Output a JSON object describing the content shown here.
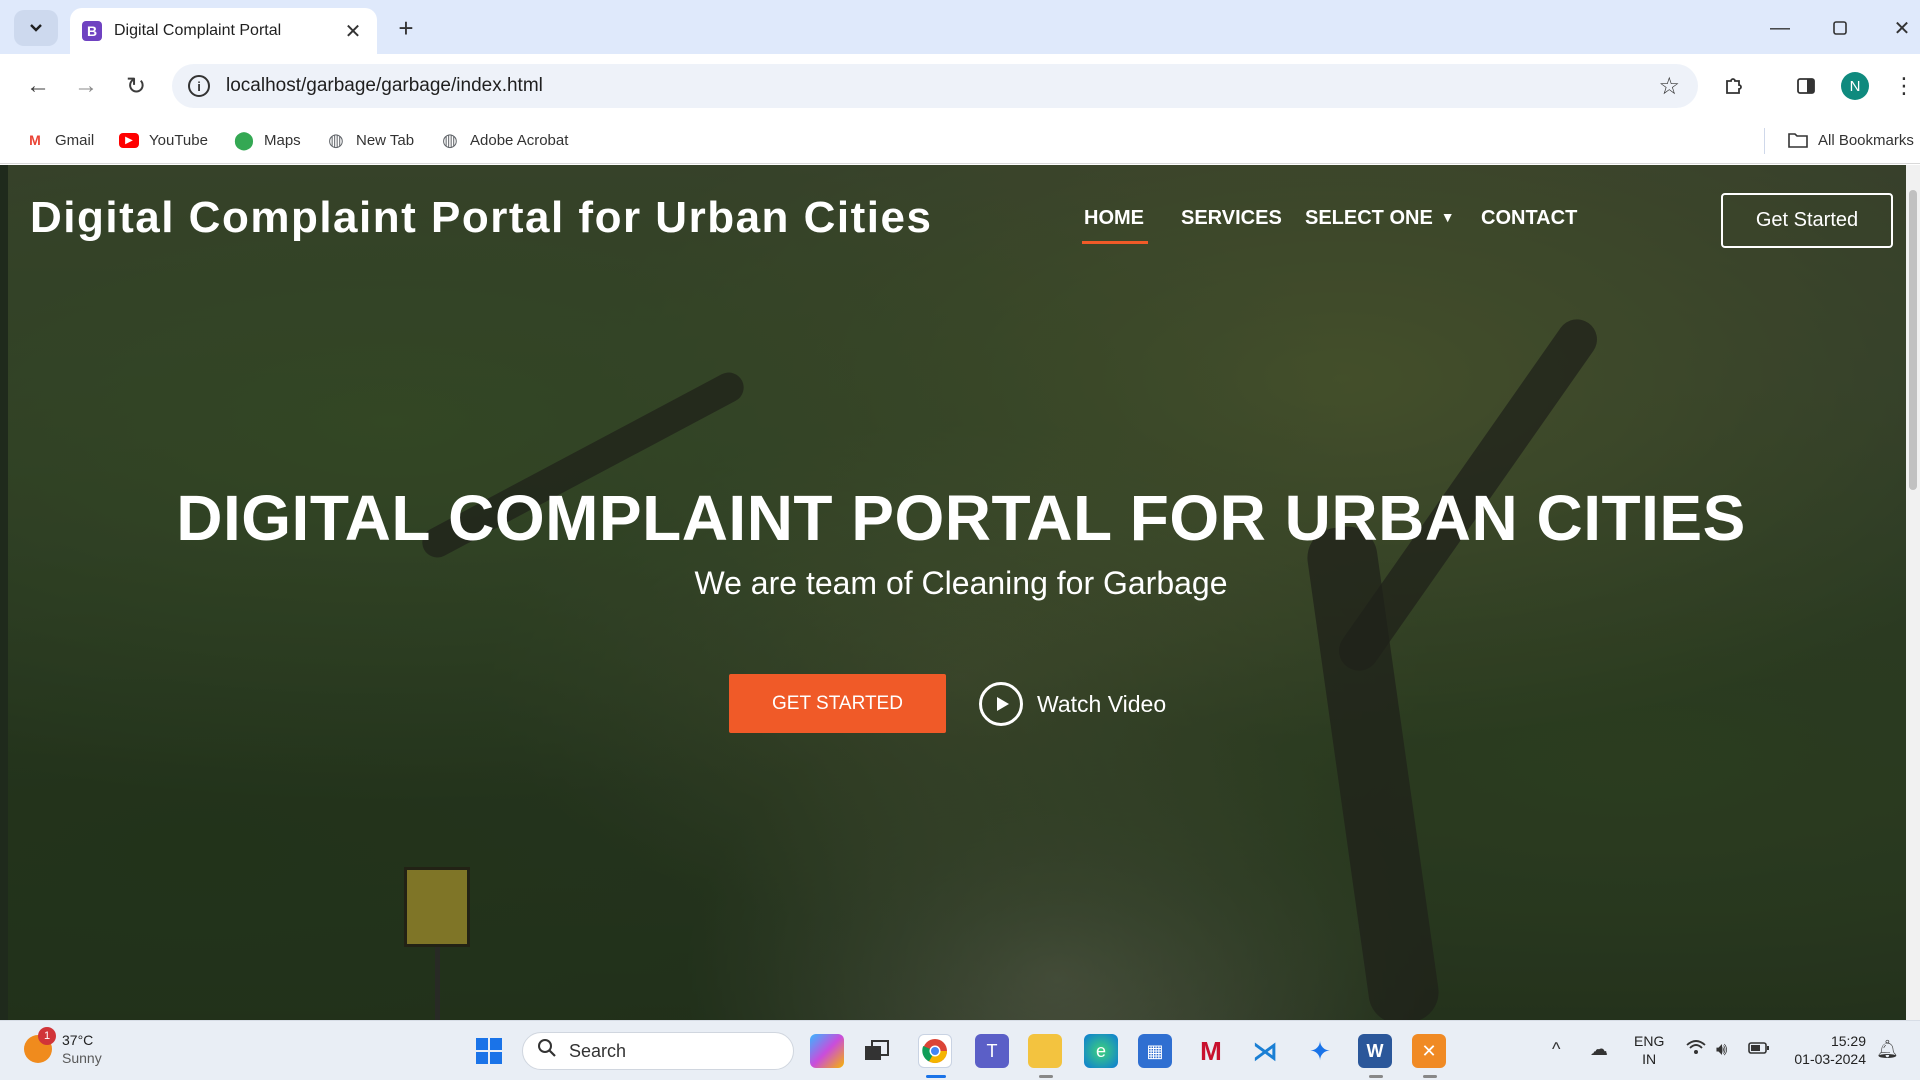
{
  "browser": {
    "tab_title": "Digital Complaint Portal",
    "tab_favicon_letter": "B",
    "url": "localhost/garbage/garbage/index.html",
    "profile_initial": "N",
    "bookmarks": [
      {
        "label": "Gmail",
        "icon": "gmail-icon",
        "color": "#ea4335"
      },
      {
        "label": "YouTube",
        "icon": "youtube-icon",
        "color": "#ff0000"
      },
      {
        "label": "Maps",
        "icon": "maps-icon",
        "color": "#34a853"
      },
      {
        "label": "New Tab",
        "icon": "globe-icon",
        "color": "#5f6368"
      },
      {
        "label": "Adobe Acrobat",
        "icon": "globe-icon",
        "color": "#5f6368"
      }
    ],
    "all_bookmarks_label": "All Bookmarks"
  },
  "site": {
    "logo": "Digital Complaint Portal for Urban Cities",
    "nav": {
      "home": "HOME",
      "services": "SERVICES",
      "select_one": "SELECT ONE",
      "contact": "CONTACT"
    },
    "nav_cta": "Get Started",
    "hero": {
      "title": "DIGITAL COMPLAINT PORTAL FOR URBAN CITIES",
      "subtitle": "We are team of Cleaning for Garbage",
      "primary_button": "GET STARTED",
      "watch_video": "Watch Video"
    },
    "accent_color": "#f05a28"
  },
  "taskbar": {
    "weather_temp": "37°C",
    "weather_condition": "Sunny",
    "weather_badge": "1",
    "search_placeholder": "Search",
    "lang_top": "ENG",
    "lang_bottom": "IN",
    "time": "15:29",
    "date": "01-03-2024"
  }
}
